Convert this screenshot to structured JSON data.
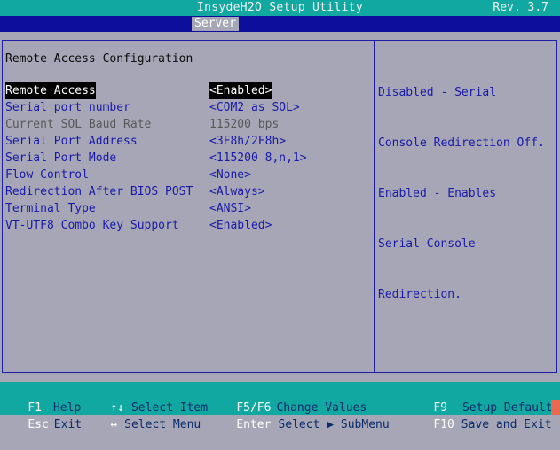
{
  "header": {
    "title": "InsydeH2O Setup Utility",
    "revision": "Rev. 3.7"
  },
  "menu": {
    "active_tab": "Server"
  },
  "page": {
    "section_title": "Remote Access Configuration",
    "items": [
      {
        "label": "Remote Access",
        "value": "<Enabled>"
      },
      {
        "label": "Serial port number",
        "value": "<COM2 as SOL>"
      },
      {
        "label": "Current SOL Baud Rate",
        "value": "115200 bps"
      },
      {
        "label": "Serial Port Address",
        "value": "<3F8h/2F8h>"
      },
      {
        "label": "Serial Port Mode",
        "value": "<115200 8,n,1>"
      },
      {
        "label": "Flow Control",
        "value": "<None>"
      },
      {
        "label": "Redirection After BIOS POST",
        "value": "<Always>"
      },
      {
        "label": "Terminal Type",
        "value": "<ANSI>"
      },
      {
        "label": "VT-UTF8 Combo Key Support",
        "value": "<Enabled>"
      }
    ]
  },
  "help": {
    "lines": [
      "Disabled - Serial",
      "Console Redirection Off.",
      "Enabled - Enables",
      "Serial Console",
      "Redirection."
    ]
  },
  "footer": {
    "keys": [
      {
        "key": "F1",
        "desc": "Help"
      },
      {
        "key": "Esc",
        "desc": "Exit"
      },
      {
        "key": "↑↓",
        "desc": "Select Item"
      },
      {
        "key": "↔",
        "desc": "Select Menu"
      },
      {
        "key": "F5/F6",
        "desc": "Change Values"
      },
      {
        "key": "Enter",
        "desc": "Select ▶ SubMenu"
      },
      {
        "key": "F9",
        "desc": "Setup Defaults"
      },
      {
        "key": "F10",
        "desc": "Save and Exit"
      }
    ]
  },
  "colors": {
    "teal_bar": "#10a8a0",
    "menu_bar": "#0e0e9c",
    "background": "#a6a6b6",
    "item_text": "#1a1aa8",
    "disabled_text": "#585858",
    "selected_bg": "#000000"
  }
}
